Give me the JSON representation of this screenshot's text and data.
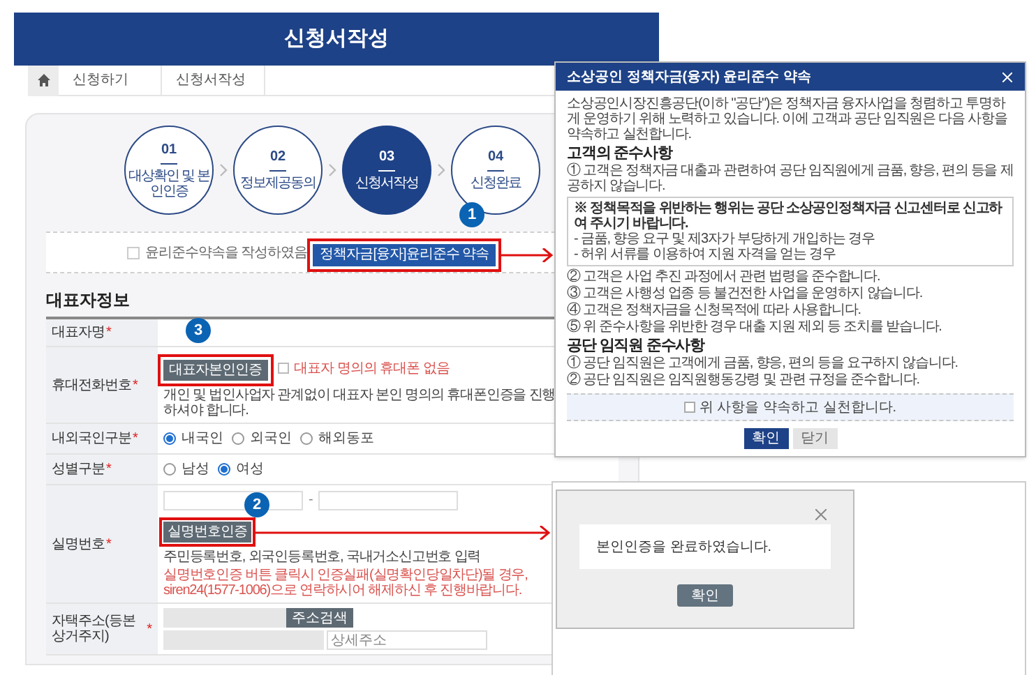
{
  "header": {
    "title": "신청서작성"
  },
  "breadcrumb": [
    "신청하기",
    "신청서작성"
  ],
  "steps": [
    {
      "number": "01",
      "label": "대상확인 및 본인인증",
      "selected": false
    },
    {
      "number": "02",
      "label": "정보제공동의",
      "selected": false
    },
    {
      "number": "03",
      "label": "신청서작성",
      "selected": true
    },
    {
      "number": "04",
      "label": "신청완료",
      "selected": false
    }
  ],
  "agreement": {
    "checkbox_label": "윤리준수약속을 작성하였음",
    "checked": false,
    "button": "정책자금[융자]윤리준수 약속",
    "callout": "1"
  },
  "section_title": "대표자정보",
  "form_rows": [
    {
      "kind": "empty",
      "label": "대표자명",
      "required_mark": "*"
    },
    {
      "kind": "phone",
      "label": "휴대전화번호",
      "required_mark": "*",
      "button": "대표자본인인증",
      "callout": "3",
      "checkbox_label": "대표자 명의의 휴대폰 없음",
      "checked": false,
      "note": "개인 및 법인사업자 관계없이 대표자 본인 명의의 휴대폰인증을 진행하셔야 합니다."
    },
    {
      "kind": "radio",
      "label": "내외국인구분",
      "required_mark": "*",
      "options": [
        {
          "label": "내국인",
          "selected": true
        },
        {
          "label": "외국인",
          "selected": false
        },
        {
          "label": "해외동포",
          "selected": false
        }
      ]
    },
    {
      "kind": "radio",
      "label": "성별구분",
      "required_mark": "*",
      "options": [
        {
          "label": "남성",
          "selected": false
        },
        {
          "label": "여성",
          "selected": true
        }
      ]
    },
    {
      "kind": "id_number",
      "label": "실명번호",
      "required_mark": "*",
      "separator": "-",
      "button": "실명번호인증",
      "callout": "2",
      "note": "주민등록번호, 외국인등록번호, 국내거소신고번호 입력",
      "warning": "실명번호인증 버튼 클릭시 인증실패(실명확인당일차단)될 경우, siren24(1577-1006)으로 연락하시어 해제하신 후 진행바랍니다."
    },
    {
      "kind": "address",
      "label": "자택주소(등본상거주지)",
      "required_mark": "*",
      "button": "주소검색",
      "detail_placeholder": "상세주소"
    }
  ],
  "ethics_modal": {
    "title": "소상공인 정책자금(융자) 윤리준수 약속",
    "intro": "소상공인시장진흥공단(이하 \"공단\")은 정책자금 융자사업을 청렴하고 투명하게 운영하기 위해 노력하고 있습니다. 이에 고객과 공단 임직원은 다음 사항을 약속하고 실천합니다.",
    "sections": [
      {
        "heading": "고객의 준수사항",
        "blocks": [
          {
            "kind": "item",
            "text": "① 고객은 정책자금 대출과 관련하여 공단 임직원에게 금품, 향응, 편의 등을 제공하지 않습니다."
          },
          {
            "kind": "box",
            "text": "※ 정책목적을 위반하는 행위는 공단 소상공인정책자금 신고센터로 신고하여 주시기 바랍니다.",
            "bullets": [
              "- 금품, 향응 요구 및 제3자가 부당하게 개입하는 경우",
              "- 허위 서류를 이용하여 지원 자격을 얻는 경우"
            ]
          },
          {
            "kind": "item",
            "text": "② 고객은 사업 추진 과정에서 관련 법령을 준수합니다."
          },
          {
            "kind": "item",
            "text": "③ 고객은 사행성 업종 등 불건전한 사업을 운영하지 않습니다."
          },
          {
            "kind": "item",
            "text": "④ 고객은 정책자금을 신청목적에 따라 사용합니다."
          },
          {
            "kind": "item",
            "text": "⑤ 위 준수사항을 위반한 경우 대출 지원 제외 등 조치를 받습니다."
          }
        ]
      },
      {
        "heading": "공단 임직원 준수사항",
        "blocks": [
          {
            "kind": "item",
            "text": "① 공단 임직원은 고객에게 금품, 향응, 편의 등을 요구하지 않습니다."
          },
          {
            "kind": "item",
            "text": "② 공단 임직원은 임직원행동강령 및 관련 규정을 준수합니다."
          }
        ]
      }
    ],
    "pledge": {
      "label": "위 사항을 약속하고 실천합니다.",
      "checked": false
    },
    "buttons": [
      {
        "label": "확인",
        "primary": true
      },
      {
        "label": "닫기",
        "primary": false
      }
    ]
  },
  "confirm_dialog": {
    "message": "본인인증을 완료하였습니다.",
    "button": "확인"
  }
}
